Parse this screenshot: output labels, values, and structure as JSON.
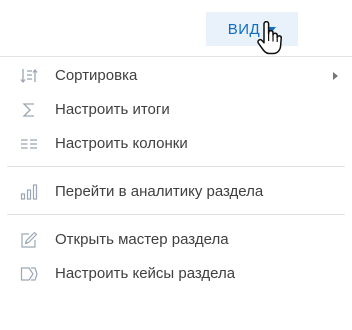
{
  "view_button": {
    "label": "ВИД",
    "accent_color": "#0d6fc4",
    "background_color": "#e9f1fb"
  },
  "cursor": {
    "icon": "hand-pointer-icon"
  },
  "menu": {
    "items": [
      {
        "label": "Сортировка",
        "icon": "sort-icon",
        "has_submenu": true
      },
      {
        "label": "Настроить итоги",
        "icon": "sum-sigma-icon",
        "has_submenu": false
      },
      {
        "label": "Настроить колонки",
        "icon": "columns-icon",
        "has_submenu": false
      },
      {
        "label": "Перейти в аналитику раздела",
        "icon": "bar-chart-icon",
        "has_submenu": false
      },
      {
        "label": "Открыть мастер раздела",
        "icon": "pencil-edit-icon",
        "has_submenu": false
      },
      {
        "label": "Настроить кейсы раздела",
        "icon": "case-flow-icon",
        "has_submenu": false
      }
    ]
  }
}
